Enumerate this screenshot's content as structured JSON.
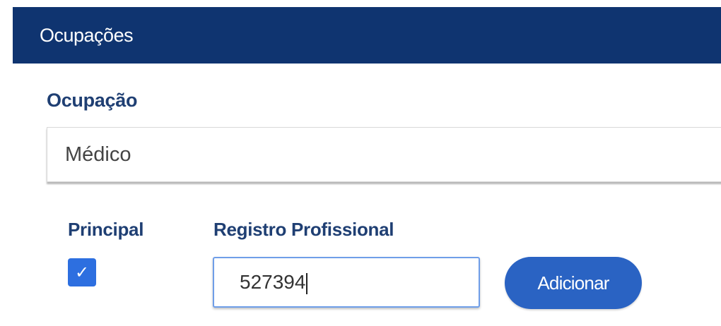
{
  "panel": {
    "title": "Ocupações"
  },
  "form": {
    "occupation_label": "Ocupação",
    "occupation_value": "Médico",
    "principal_label": "Principal",
    "principal_checked": true,
    "registro_label": "Registro Profissional",
    "registro_value": "527394",
    "add_button_label": "Adicionar"
  },
  "icons": {
    "checkbox_check": "check-icon"
  },
  "colors": {
    "header_bg": "#0f3470",
    "label_text": "#1f3f73",
    "checkbox_bg": "#2d6fe0",
    "button_bg": "#2a63c3",
    "input_focus_border": "#6f9ee8"
  }
}
